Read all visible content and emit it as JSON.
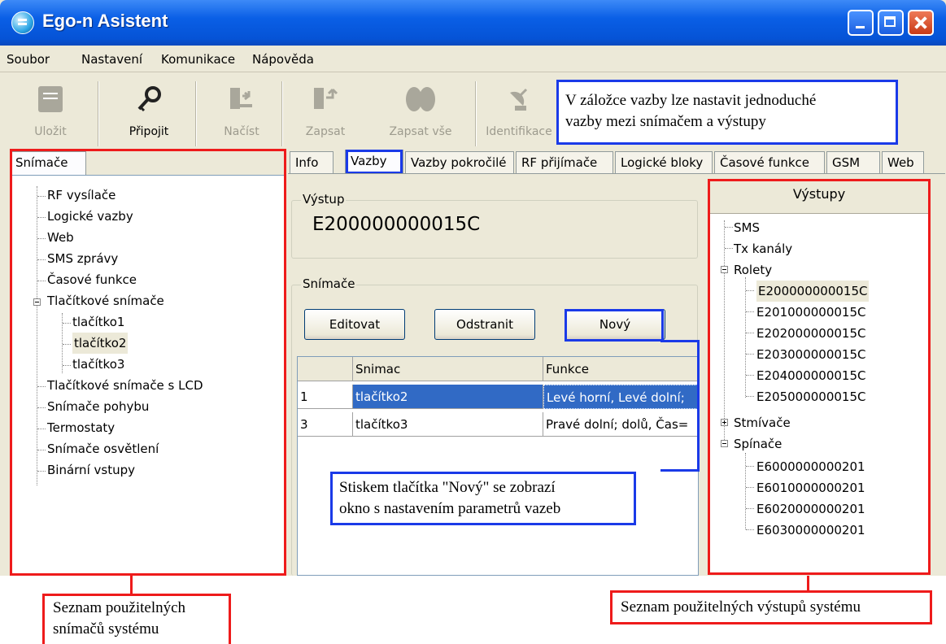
{
  "window": {
    "title": "Ego-n Asistent"
  },
  "menu": [
    "Soubor",
    "Nastavení",
    "Komunikace",
    "Nápověda"
  ],
  "toolbar": {
    "save": "Uložit",
    "connect": "Připojit",
    "load": "Načíst",
    "write": "Zapsat",
    "write_all": "Zapsat vše",
    "identify": "Identifikace"
  },
  "left_panel": {
    "tab": "Snímače",
    "items": [
      "RF vysílače",
      "Logické vazby",
      "Web",
      "SMS zprávy",
      "Časové funkce",
      "Tlačítkové snímače",
      "tlačítko1",
      "tlačítko2",
      "tlačítko3",
      "Tlačítkové snímače s LCD",
      "Snímače pohybu",
      "Termostaty",
      "Snímače osvětlení",
      "Binární vstupy"
    ]
  },
  "tabs": [
    "Info",
    "Vazby",
    "Vazby pokročilé",
    "RF přijímače",
    "Logické bloky",
    "Časové funkce",
    "GSM",
    "Web"
  ],
  "output_group": {
    "label": "Výstup",
    "value": "E200000000015C"
  },
  "sensors_group": {
    "label": "Snímače",
    "edit": "Editovat",
    "remove": "Odstranit",
    "new": "Nový"
  },
  "grid": {
    "columns": [
      "Snimac",
      "Funkce"
    ],
    "rows": [
      {
        "num": "1",
        "snimac": "tlačítko2",
        "funkce": "Levé horní, Levé dolní;"
      },
      {
        "num": "3",
        "snimac": "tlačítko3",
        "funkce": "Pravé dolní; dolů, Čas="
      }
    ]
  },
  "outputs_panel": {
    "title": "Výstupy",
    "items": [
      "SMS",
      "Tx kanály",
      "Rolety",
      "E200000000015C",
      "E201000000015C",
      "E202000000015C",
      "E203000000015C",
      "E204000000015C",
      "E205000000015C",
      "Stmívače",
      "Spínače",
      "E6000000000201",
      "E6010000000201",
      "E6020000000201",
      "E6030000000201"
    ]
  },
  "annotations": {
    "vazby_note_line1": "V záložce vazby lze nastavit jednoduché",
    "vazby_note_line2": "vazby mezi snímačem a výstupy",
    "novy_note_line1": "Stiskem tlačítka \"Nový\" se zobrazí",
    "novy_note_line2": "okno s nastavením parametrů vazeb",
    "sensors_note_line1": "Seznam použitelných",
    "sensors_note_line2": "snímačů systému",
    "outputs_note": "Seznam použitelných výstupů systému"
  },
  "colors": {
    "title_bar": "#0553d6",
    "selection": "#316ac5",
    "annotation_blue": "#1a3ae8",
    "annotation_red": "#ee1b1b"
  }
}
